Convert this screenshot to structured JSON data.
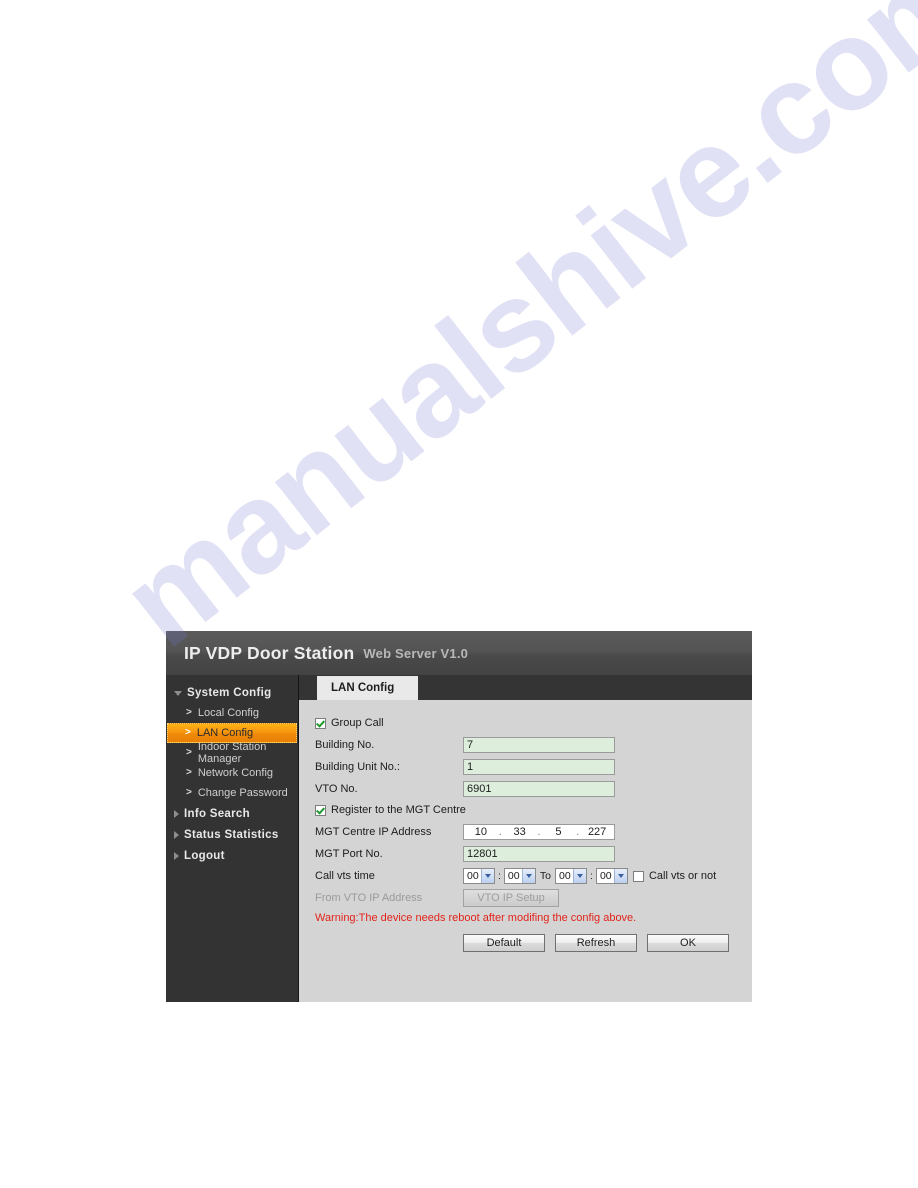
{
  "watermark": {
    "text": "manualshive.com"
  },
  "header": {
    "brand": "IP VDP Door Station",
    "subtitle": "Web Server V1.0"
  },
  "sidebar": {
    "groups": [
      {
        "label": "System Config",
        "expanded": true,
        "items": [
          {
            "label": "Local Config",
            "active": false
          },
          {
            "label": "LAN Config",
            "active": true
          },
          {
            "label": "Indoor Station Manager",
            "active": false
          },
          {
            "label": "Network Config",
            "active": false
          },
          {
            "label": "Change Password",
            "active": false
          }
        ]
      },
      {
        "label": "Info Search",
        "expanded": false,
        "items": []
      },
      {
        "label": "Status Statistics",
        "expanded": false,
        "items": []
      },
      {
        "label": "Logout",
        "expanded": false,
        "items": []
      }
    ]
  },
  "tabs": [
    {
      "label": "LAN Config",
      "active": true
    }
  ],
  "form": {
    "group_call": {
      "label": "Group Call",
      "checked": true
    },
    "building_no": {
      "label": "Building No.",
      "value": "7"
    },
    "building_unit_no": {
      "label": "Building Unit No.:",
      "value": "1"
    },
    "vto_no": {
      "label": "VTO No.",
      "value": "6901"
    },
    "register_mgt": {
      "label": "Register to the MGT Centre",
      "checked": true
    },
    "mgt_ip": {
      "label": "MGT Centre IP Address",
      "octets": [
        "10",
        "33",
        "5",
        "227"
      ],
      "separator": "."
    },
    "mgt_port": {
      "label": "MGT Port No.",
      "value": "12801"
    },
    "call_vts_time": {
      "label": "Call vts time",
      "start_hour": "00",
      "start_minute": "00",
      "to_label": "To",
      "end_hour": "00",
      "end_minute": "00",
      "time_separator": ":",
      "checkbox_label": "Call vts or not",
      "checkbox_checked": false
    },
    "from_vto_ip": {
      "label": "From VTO IP Address",
      "button_label": "VTO IP Setup",
      "disabled": true
    },
    "warning": "Warning:The device needs reboot after modifing the config above.",
    "buttons": [
      {
        "label": "Default"
      },
      {
        "label": "Refresh"
      },
      {
        "label": "OK"
      }
    ]
  },
  "colors": {
    "accent_orange": "#f79410",
    "warning_red": "#e2231a",
    "input_green": "#ddeedd",
    "sidebar_dark": "#333333",
    "header_gray": "#545454"
  }
}
